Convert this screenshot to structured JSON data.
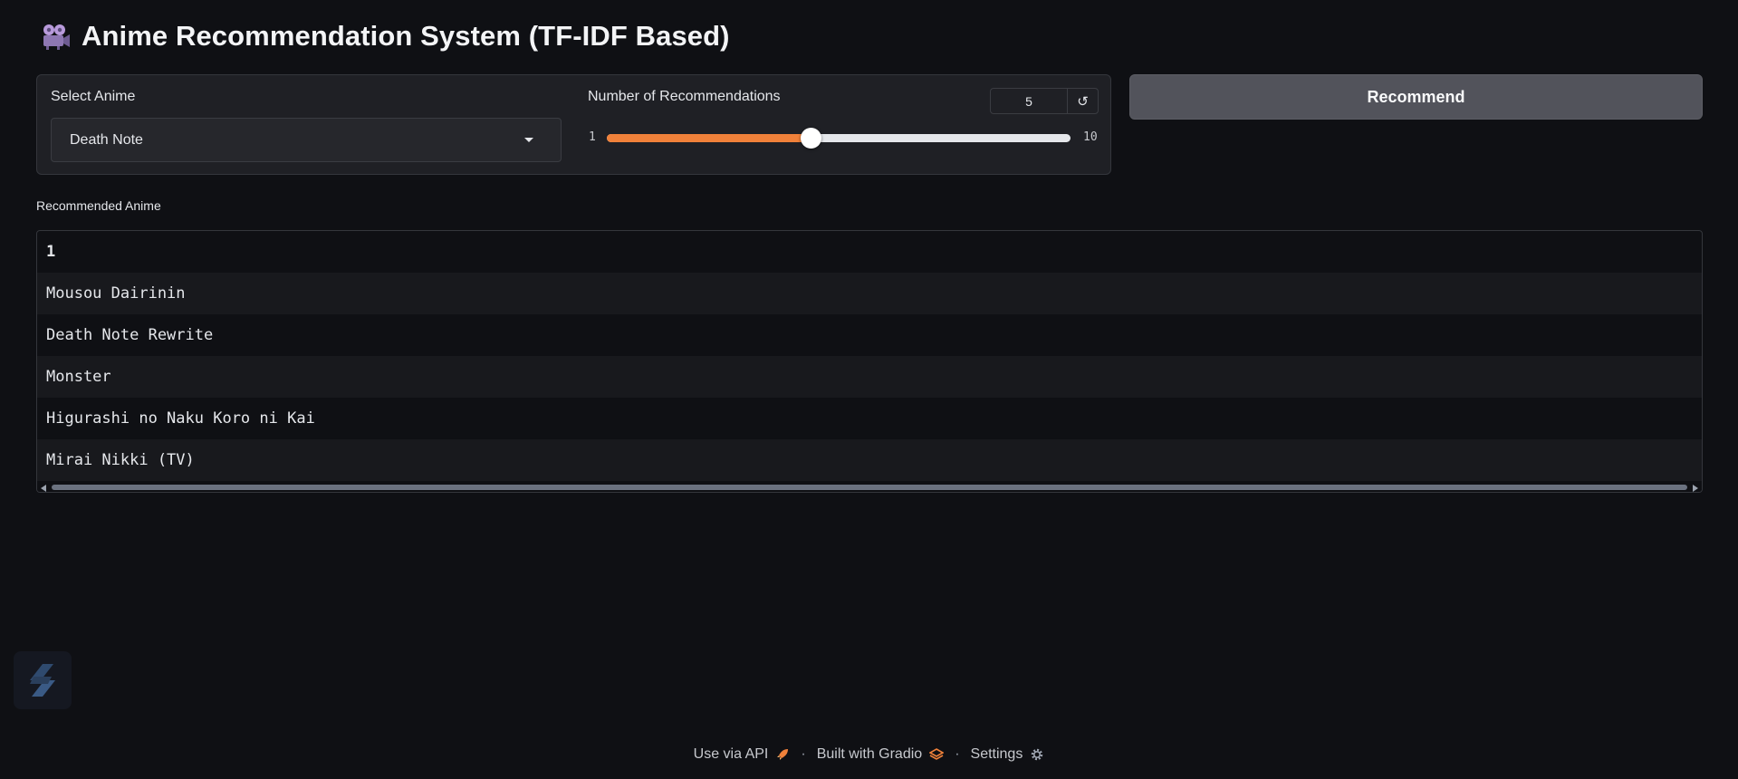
{
  "title": "Anime Recommendation System (TF-IDF Based)",
  "title_icon": "movie-camera-icon",
  "select": {
    "label": "Select Anime",
    "value": "Death Note"
  },
  "slider": {
    "label": "Number of Recommendations",
    "value": "5",
    "min": "1",
    "max": "10",
    "fill_fraction": 0.44
  },
  "recommend_label": "Recommend",
  "output": {
    "label": "Recommended Anime",
    "header": "1",
    "rows": [
      "Mousou Dairinin",
      "Death Note Rewrite",
      "Monster",
      "Higurashi no Naku Koro ni Kai",
      "Mirai Nikki (TV)"
    ]
  },
  "footer": {
    "api": "Use via API",
    "built": "Built with Gradio",
    "settings": "Settings"
  },
  "colors": {
    "accent": "#f0813a",
    "background": "#0f1014",
    "panel": "#1f2025",
    "button": "#52535b"
  }
}
